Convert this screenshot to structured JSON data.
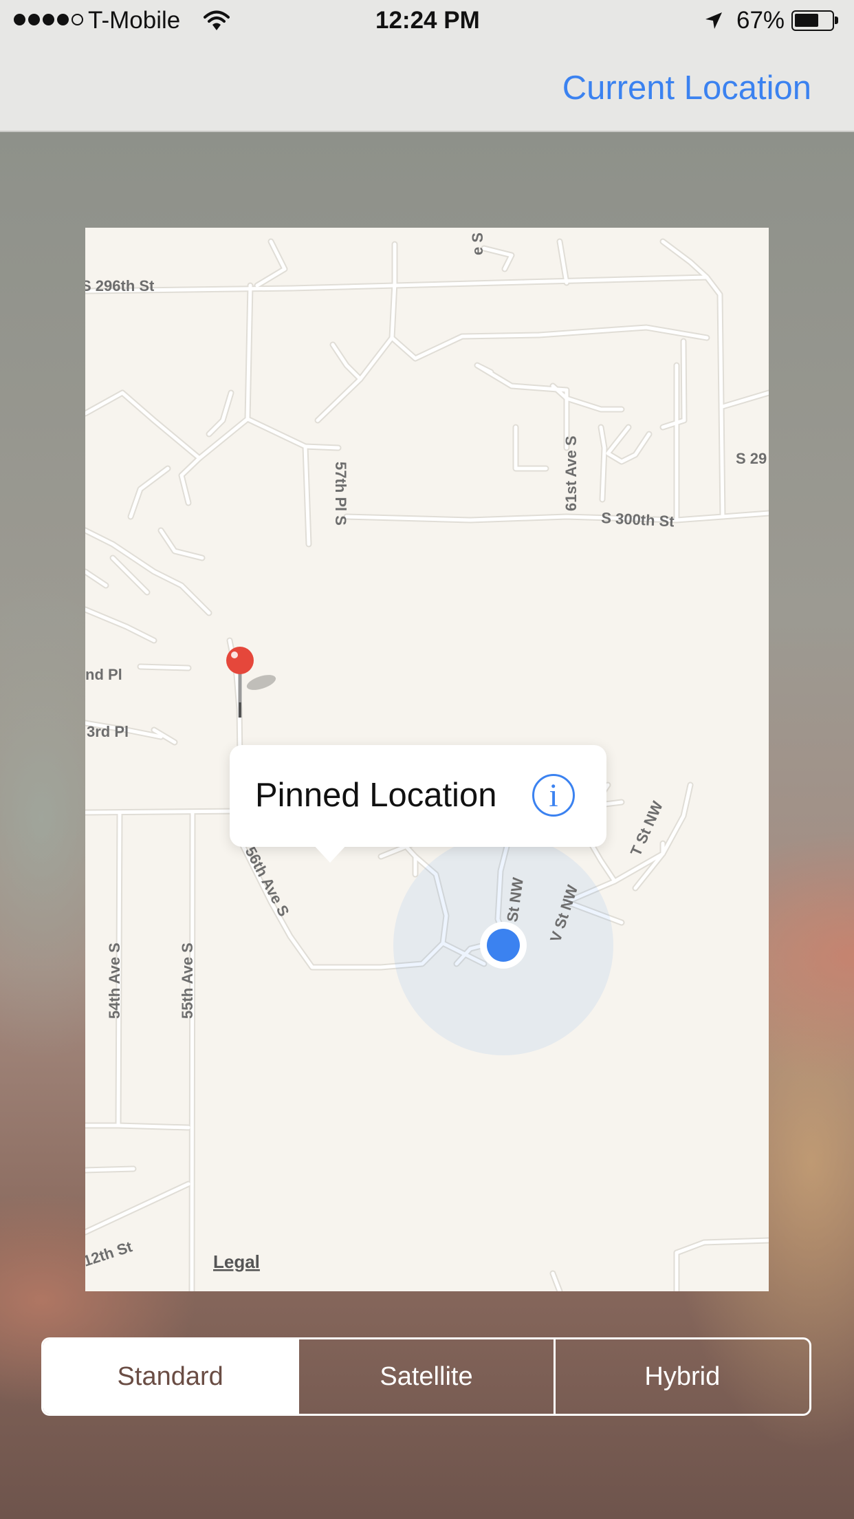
{
  "status_bar": {
    "carrier": "T-Mobile",
    "time": "12:24 PM",
    "battery_percent": "67%",
    "battery_level": 0.67,
    "signal_bars_filled": 4,
    "signal_bars_total": 5
  },
  "nav": {
    "current_location_label": "Current Location"
  },
  "map": {
    "streets": {
      "s296th": "S 296th St",
      "s300th": "S 300th St",
      "s29": "S 29",
      "ave57": "57th Pl S",
      "ave61": "61st Ave S",
      "nd_pl": "nd Pl",
      "rd_pl": "3rd Pl",
      "ave56": "56th Ave S",
      "ave54": "54th Ave S",
      "ave55": "55th Ave S",
      "t_st": "T St NW",
      "v_st": "V St NW",
      "u_st": "St NW",
      "twelfth": "12th St",
      "e_s": "e S"
    },
    "legal_label": "Legal",
    "pin_color": "#e5473b",
    "user_location_color": "#3b82f0"
  },
  "callout": {
    "title": "Pinned Location",
    "info_glyph": "i"
  },
  "map_type": {
    "options": [
      "Standard",
      "Satellite",
      "Hybrid"
    ],
    "selected": "Standard"
  },
  "colors": {
    "accent": "#3b82f0",
    "map_background": "#f7f4ee"
  }
}
